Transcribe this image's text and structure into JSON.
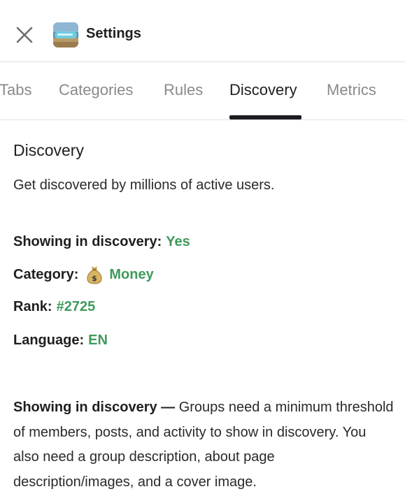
{
  "header": {
    "title": "Settings",
    "close_icon": "close-icon",
    "avatar_icon": "group-avatar"
  },
  "tabs": [
    {
      "label": "Tabs",
      "active": false
    },
    {
      "label": "Categories",
      "active": false
    },
    {
      "label": "Rules",
      "active": false
    },
    {
      "label": "Discovery",
      "active": true
    },
    {
      "label": "Metrics",
      "active": false
    }
  ],
  "discovery": {
    "title": "Discovery",
    "description": "Get discovered by millions of active users.",
    "showing": {
      "label": "Showing in discovery:",
      "value": "Yes"
    },
    "category": {
      "label": "Category:",
      "icon": "money-bag-icon",
      "value": "Money"
    },
    "rank": {
      "label": "Rank:",
      "value": "#2725"
    },
    "language": {
      "label": "Language:",
      "value": "EN"
    },
    "note": {
      "strong": "Showing in discovery —",
      "text": " Groups need a minimum threshold of members, posts, and activity to show in discovery. You also need a group description, about page description/images, and a cover image."
    }
  },
  "colors": {
    "accent_green": "#3f9a5b",
    "tab_active": "#1c1c22",
    "tab_inactive": "#8a8a8a",
    "divider": "#e2e2e2"
  }
}
